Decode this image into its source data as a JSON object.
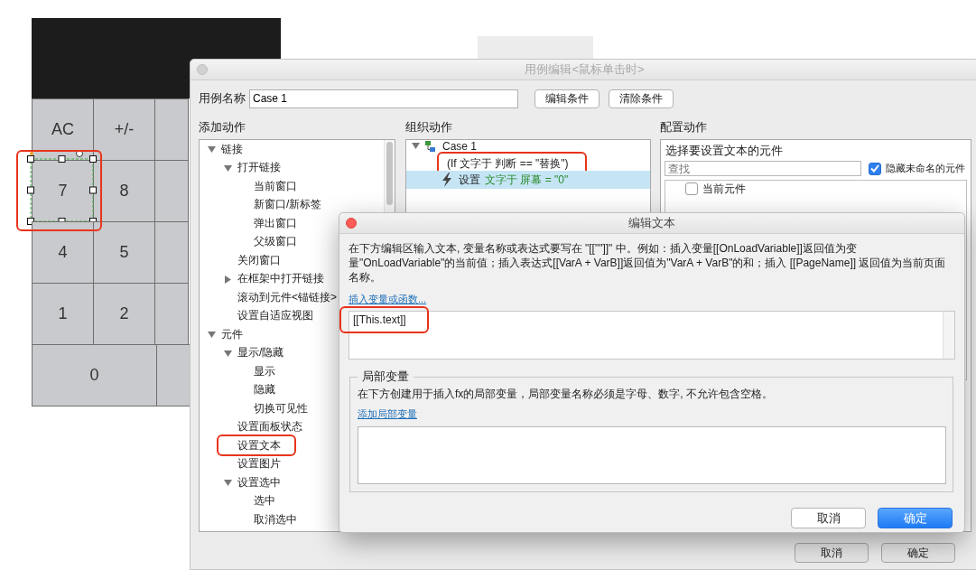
{
  "calculator": {
    "keys": [
      [
        {
          "label": "AC",
          "wide": false,
          "selected": false
        },
        {
          "label": "+/-",
          "wide": false,
          "selected": false
        }
      ],
      [
        {
          "label": "7",
          "wide": false,
          "selected": true
        },
        {
          "label": "8",
          "wide": false,
          "selected": false
        }
      ],
      [
        {
          "label": "4",
          "wide": false,
          "selected": false
        },
        {
          "label": "5",
          "wide": false,
          "selected": false
        }
      ],
      [
        {
          "label": "1",
          "wide": false,
          "selected": false
        },
        {
          "label": "2",
          "wide": false,
          "selected": false
        }
      ],
      [
        {
          "label": "0",
          "wide": true,
          "selected": false
        }
      ]
    ]
  },
  "window": {
    "title": "用例编辑<鼠标单击时>",
    "case_name_label": "用例名称",
    "case_name": "Case 1",
    "buttons": [
      "编辑条件",
      "清除条件"
    ],
    "add_actions": {
      "title": "添加动作",
      "items": [
        {
          "label": "链接",
          "expanded": true,
          "children": [
            {
              "label": "打开链接",
              "expanded": true,
              "children": [
                {
                  "label": "当前窗口"
                },
                {
                  "label": "新窗口/新标签"
                },
                {
                  "label": "弹出窗口"
                },
                {
                  "label": "父级窗口"
                }
              ]
            },
            {
              "label": "关闭窗口"
            },
            {
              "label": "在框架中打开链接",
              "expanded": false
            },
            {
              "label": "滚动到元件<锚链接>"
            },
            {
              "label": "设置自适应视图"
            }
          ]
        },
        {
          "label": "元件",
          "expanded": true,
          "children": [
            {
              "label": "显示/隐藏",
              "expanded": true,
              "children": [
                {
                  "label": "显示"
                },
                {
                  "label": "隐藏"
                },
                {
                  "label": "切换可见性"
                }
              ]
            },
            {
              "label": "设置面板状态"
            },
            {
              "label": "设置文本"
            },
            {
              "label": "设置图片"
            },
            {
              "label": "设置选中",
              "expanded": true,
              "children": [
                {
                  "label": "选中"
                },
                {
                  "label": "取消选中"
                }
              ]
            }
          ]
        }
      ]
    },
    "organize_actions": {
      "title": "组织动作",
      "cases": [
        {
          "name": "Case 1",
          "expanded": true,
          "condition": "(If 文字于 判断 == \"替换\")",
          "actions": [
            {
              "verb": "设置",
              "target": "文字于 屏幕 = \"0\"",
              "selected": true
            }
          ]
        }
      ]
    },
    "configure_actions": {
      "title": "配置动作",
      "heading": "选择要设置文本的元件",
      "search": {
        "placeholder": "查找"
      },
      "hide_unnamed": {
        "label": "隐藏未命名的元件",
        "checked": true
      },
      "widgets": [
        {
          "label": "当前元件",
          "checked": false
        }
      ]
    },
    "footer_buttons": [
      {
        "label": "取消",
        "primary": false
      },
      {
        "label": "确定",
        "primary": false
      }
    ]
  },
  "dialog": {
    "title": "编辑文本",
    "description": "在下方编辑区输入文本, 变量名称或表达式要写在 \"[[\"\"]]\" 中。例如：插入变量[[OnLoadVariable]]返回值为变量\"OnLoadVariable\"的当前值；插入表达式[[VarA + VarB]]返回值为\"VarA + VarB\"的和；插入 [[PageName]] 返回值为当前页面名称。",
    "insert_link": "插入变量或函数...",
    "text_value": "[[This.text]]",
    "local_vars": {
      "title": "局部变量",
      "description": "在下方创建用于插入fx的局部变量，局部变量名称必须是字母、数字, 不允许包含空格。",
      "add_link": "添加局部变量"
    },
    "buttons": [
      {
        "label": "取消",
        "primary": false
      },
      {
        "label": "确定",
        "primary": true
      }
    ]
  }
}
